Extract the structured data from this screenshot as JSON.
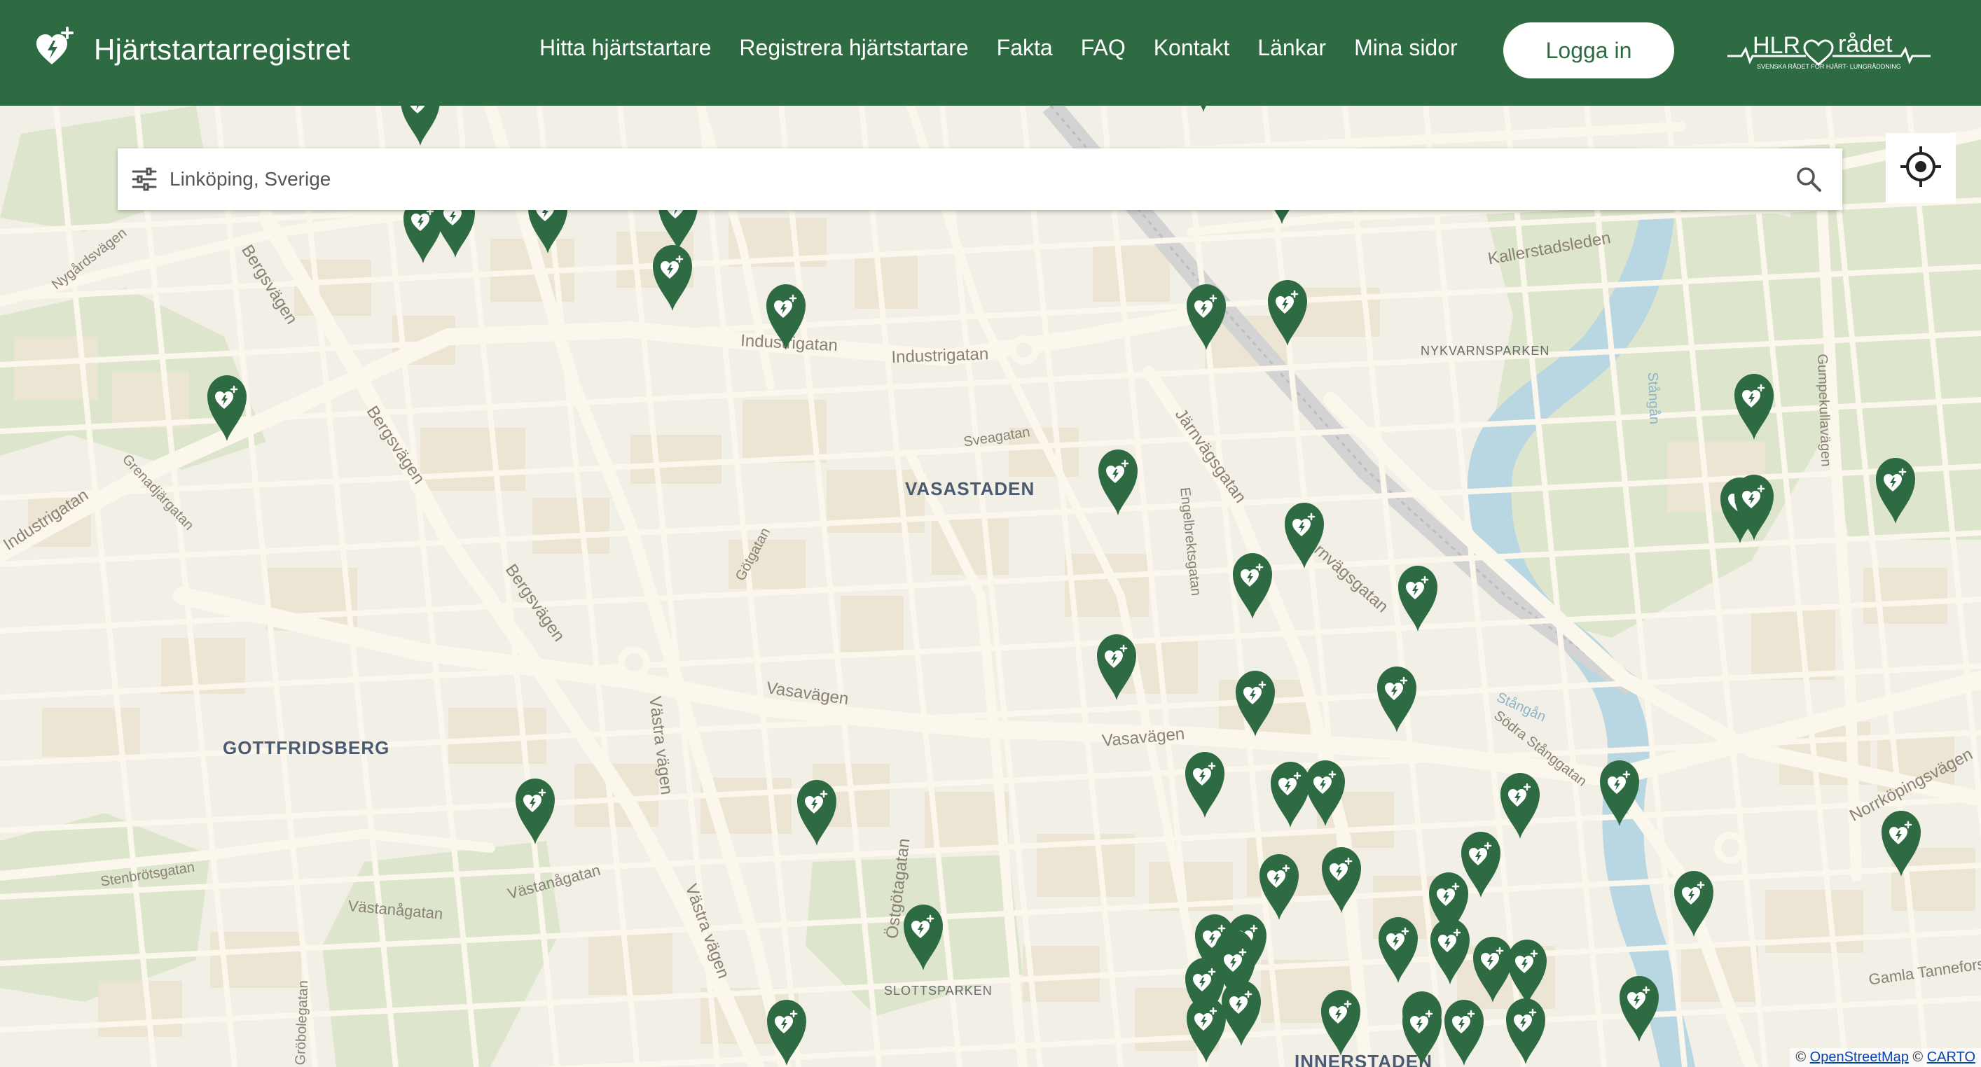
{
  "header": {
    "site_title": "Hjärtstartarregistret",
    "nav": [
      "Hitta hjärtstartare",
      "Registrera hjärtstartare",
      "Fakta",
      "FAQ",
      "Kontakt",
      "Länkar",
      "Mina sidor"
    ],
    "login_label": "Logga in",
    "partner_logo": {
      "name": "HLR rådet",
      "tagline": "SVENSKA RÅDET FÖR HJÄRT- LUNGRÄDDNING"
    },
    "colors": {
      "brand": "#2e6b42",
      "background": "#ffffff"
    }
  },
  "search": {
    "value": "Linköping, Sverige",
    "filter_icon": "sliders-icon",
    "submit_icon": "search-icon"
  },
  "map": {
    "districts": [
      "VASASTADEN",
      "GOTTFRIDSBERG",
      "INNERSTADEN"
    ],
    "parks": [
      "NYKVARNSPARKEN",
      "SLOTTSPARKEN"
    ],
    "streets": [
      "Industrigatan",
      "Industrigatan",
      "Industrigatan",
      "Bergsvägen",
      "Bergsvägen",
      "Bergsvägen",
      "Sveagatan",
      "Götgatan",
      "Vasavägen",
      "Vasavägen",
      "Västra vägen",
      "Västra vägen",
      "Östgötagatan",
      "Järnvägsgatan",
      "Järnvägsgatan",
      "Engelbrektsgatan",
      "Stenbrötsgatan",
      "Västanågatan",
      "Västanågatan",
      "Grenadjärgatan",
      "Nygårdsvägen",
      "Kallerstadsleden",
      "Södra Stånggatan",
      "Gumpekullavägen",
      "Norrköpingsvägen",
      "Gamla Tanneforsvägen",
      "Stångån",
      "Stångån",
      "Gröbolegatan"
    ],
    "marker_icon": "aed-heart-marker-icon",
    "marker_color": "#2e6b42",
    "water_color": "#b9d6e3",
    "park_color": "#dde6cc",
    "attribution": {
      "prefix": "© ",
      "osm": "OpenStreetMap",
      "sep": " © ",
      "carto": "CARTO"
    }
  },
  "locate_icon": "crosshair-icon"
}
